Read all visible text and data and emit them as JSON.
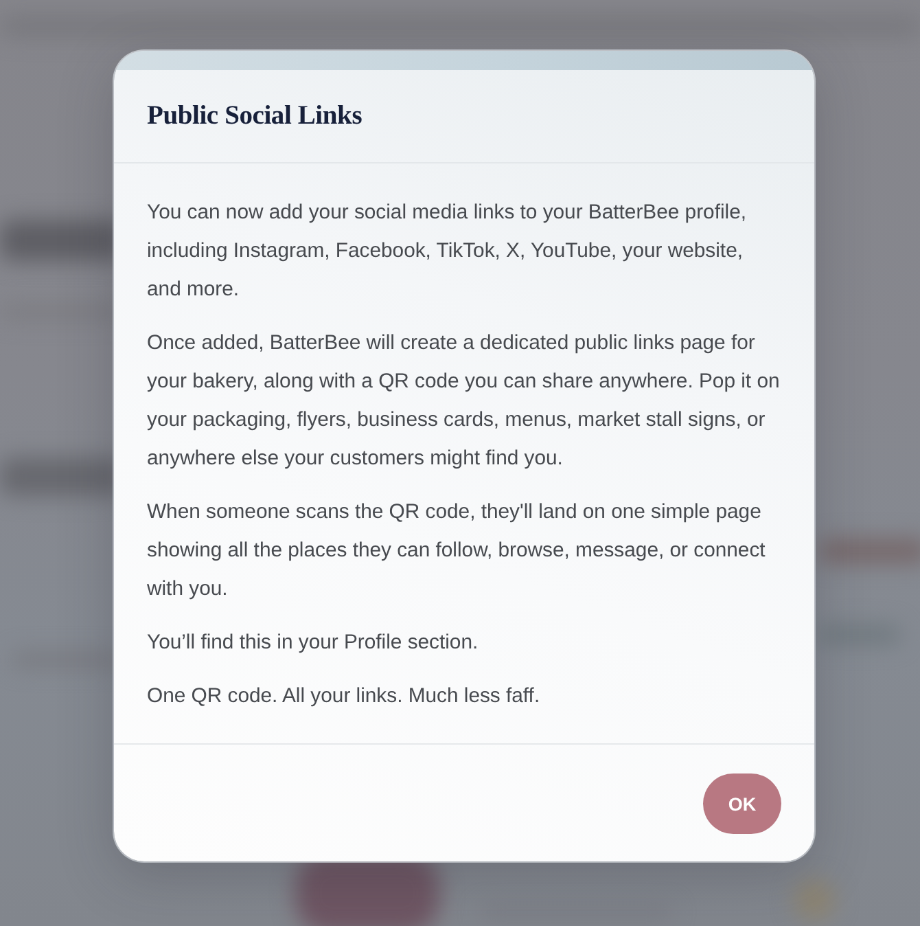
{
  "dialog": {
    "title": "Public Social Links",
    "paragraphs": [
      "You can now add your social media links to your BatterBee profile, including Instagram, Facebook, TikTok, X, YouTube, your website, and more.",
      "Once added, BatterBee will create a dedicated public links page for your bakery, along with a QR code you can share anywhere. Pop it on your packaging, flyers, business cards, menus, market stall signs, or anywhere else your customers might find you.",
      "When someone scans the QR code, they'll land on one simple page showing all the places they can follow, browse, message, or connect with you.",
      "You’ll find this in your Profile section.",
      "One QR code. All your links. Much less faff."
    ],
    "button": {
      "label": "OK"
    }
  }
}
